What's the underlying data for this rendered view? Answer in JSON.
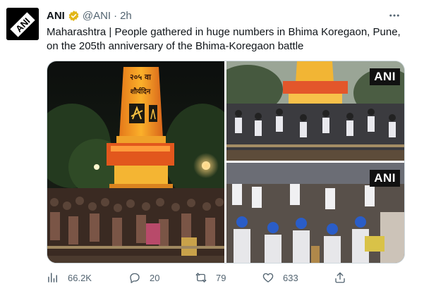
{
  "tweet": {
    "author_name": "ANI",
    "handle": "@ANI",
    "separator": "·",
    "time": "2h",
    "text": "Maharashtra | People gathered in huge numbers in Bhima Koregaon, Pune, on the 205th anniversary of the Bhima-Koregaon battle",
    "avatar_logo_text": "ANI"
  },
  "media": {
    "watermark": "ANI",
    "pillar_line1": "२०५ वा",
    "pillar_line2": "शौर्यदिन"
  },
  "actions": {
    "views": "66.2K",
    "replies": "20",
    "retweets": "79",
    "likes": "633"
  },
  "colors": {
    "accent": "#1d9bf0",
    "verified_gold": "#e2b719",
    "muted": "#536471"
  },
  "icons": [
    "verified-badge-icon",
    "more-icon",
    "views-icon",
    "reply-icon",
    "retweet-icon",
    "like-icon",
    "share-icon"
  ]
}
